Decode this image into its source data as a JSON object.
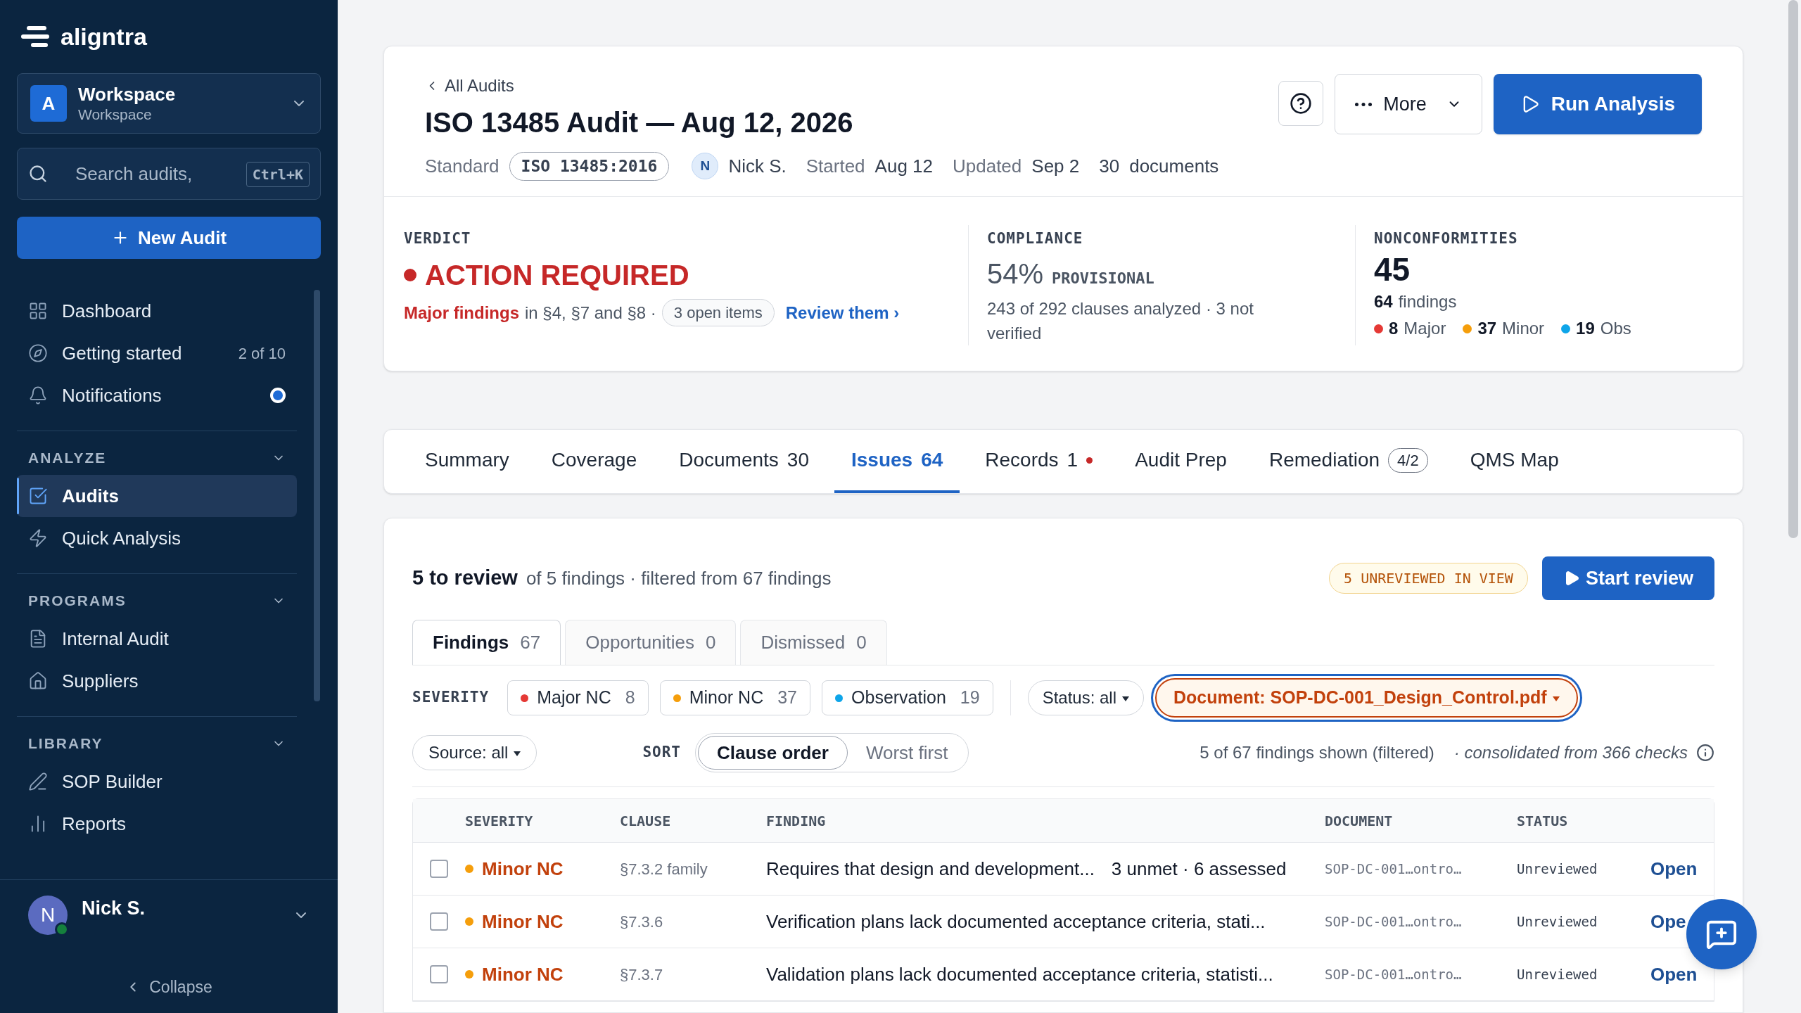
{
  "sidebar": {
    "brand": "aligntra",
    "workspace": {
      "initial": "A",
      "name": "Workspace",
      "subtitle": "Workspace"
    },
    "search": {
      "placeholder": "Search audits,",
      "shortcut": "Ctrl+K"
    },
    "new_button": "New Audit",
    "nav": [
      {
        "label": "Dashboard",
        "selected": false
      },
      {
        "label": "Getting started",
        "count": "2 of 10",
        "selected": false
      },
      {
        "label": "Notifications",
        "unread": true,
        "selected": false
      }
    ],
    "sections": [
      {
        "title": "ANALYZE",
        "expanded": true,
        "items": [
          {
            "label": "Audits",
            "selected": true
          },
          {
            "label": "Quick Analysis",
            "selected": false
          }
        ]
      },
      {
        "title": "PROGRAMS",
        "expanded": true,
        "items": [
          {
            "label": "Internal Audit",
            "selected": false
          },
          {
            "label": "Suppliers",
            "selected": false
          }
        ]
      },
      {
        "title": "LIBRARY",
        "expanded": true,
        "items": [
          {
            "label": "SOP Builder",
            "selected": false
          },
          {
            "label": "Reports",
            "selected": false
          }
        ]
      }
    ],
    "user": {
      "initial": "N",
      "name": "Nick S.",
      "online": true
    },
    "collapse": "Collapse"
  },
  "header": {
    "back": "All Audits",
    "title": "ISO 13485 Audit — Aug 12, 2026",
    "more": "More",
    "run": "Run Analysis",
    "meta": {
      "standard_label": "Standard",
      "standard": "ISO 13485:2016",
      "owner_initial": "N",
      "owner": "Nick S.",
      "started_label": "Started",
      "started": "Aug 12",
      "updated_label": "Updated",
      "updated": "Sep 2",
      "documents_count": "30",
      "documents_label": "documents"
    }
  },
  "verdict": {
    "label": "VERDICT",
    "value": "ACTION REQUIRED",
    "color": "#c62828",
    "lead": "Major findings",
    "text": "in §4, §7 and §8 ·",
    "open_items": "3 open items",
    "link": "Review them ›"
  },
  "compliance": {
    "label": "COMPLIANCE",
    "percent": "54%",
    "qualifier": "PROVISIONAL",
    "detail": "243 of 292 clauses analyzed · 3 not verified"
  },
  "nonconformities": {
    "label": "NONCONFORMITIES",
    "count": "45",
    "findings_count": "64",
    "findings_label": "findings",
    "breakdown": [
      {
        "count": "8",
        "label": "Major",
        "color": "#e53935"
      },
      {
        "count": "37",
        "label": "Minor",
        "color": "#f59e0b"
      },
      {
        "count": "19",
        "label": "Obs",
        "color": "#0ea5e9"
      }
    ]
  },
  "tabs": [
    {
      "label": "Summary",
      "selected": false
    },
    {
      "label": "Coverage",
      "selected": false
    },
    {
      "label": "Documents",
      "count": "30",
      "selected": false
    },
    {
      "label": "Issues",
      "count": "64",
      "selected": true
    },
    {
      "label": "Records",
      "count": "1",
      "alert": true,
      "selected": false
    },
    {
      "label": "Audit Prep",
      "selected": false
    },
    {
      "label": "Remediation",
      "badge": "4/2",
      "selected": false
    },
    {
      "label": "QMS Map",
      "selected": false
    }
  ],
  "review": {
    "title": "5 to review",
    "subtitle": "of 5 findings · filtered from 67 findings",
    "unreviewed": "5 UNREVIEWED IN VIEW",
    "start": "Start review"
  },
  "subtabs": [
    {
      "label": "Findings",
      "count": "67",
      "selected": true
    },
    {
      "label": "Opportunities",
      "count": "0",
      "selected": false
    },
    {
      "label": "Dismissed",
      "count": "0",
      "selected": false
    }
  ],
  "filters": {
    "severity_label": "SEVERITY",
    "severity": [
      {
        "label": "Major NC",
        "count": "8",
        "color": "#e53935"
      },
      {
        "label": "Minor NC",
        "count": "37",
        "color": "#f59e0b"
      },
      {
        "label": "Observation",
        "count": "19",
        "color": "#0ea5e9"
      }
    ],
    "status": "Status: all",
    "document": "Document: SOP-DC-001_Design_Control.pdf",
    "document_active": true,
    "source": "Source: all",
    "sort_label": "SORT",
    "sort": [
      {
        "label": "Clause order",
        "selected": true
      },
      {
        "label": "Worst first",
        "selected": false
      }
    ],
    "shown": "5 of 67 findings shown (filtered)",
    "consolidated": "· consolidated from 366 checks"
  },
  "table": {
    "columns": [
      "SEVERITY",
      "CLAUSE",
      "FINDING",
      "DOCUMENT",
      "STATUS"
    ],
    "rows": [
      {
        "checked": false,
        "severity": "Minor NC",
        "color": "#f59e0b",
        "clause": "§7.3.2 family",
        "finding": "Requires that design and development...",
        "detail": "3 unmet · 6 assessed",
        "document": "SOP-DC-001…ontro…",
        "status": "Unreviewed",
        "action": "Open"
      },
      {
        "checked": false,
        "severity": "Minor NC",
        "color": "#f59e0b",
        "clause": "§7.3.6",
        "finding": "Verification plans lack documented acceptance criteria, stati...",
        "document": "SOP-DC-001…ontro…",
        "status": "Unreviewed",
        "action": "Ope"
      },
      {
        "checked": false,
        "severity": "Minor NC",
        "color": "#f59e0b",
        "clause": "§7.3.7",
        "finding": "Validation plans lack documented acceptance criteria, statisti...",
        "document": "SOP-DC-001…ontro…",
        "status": "Unreviewed",
        "action": "Open"
      }
    ]
  }
}
